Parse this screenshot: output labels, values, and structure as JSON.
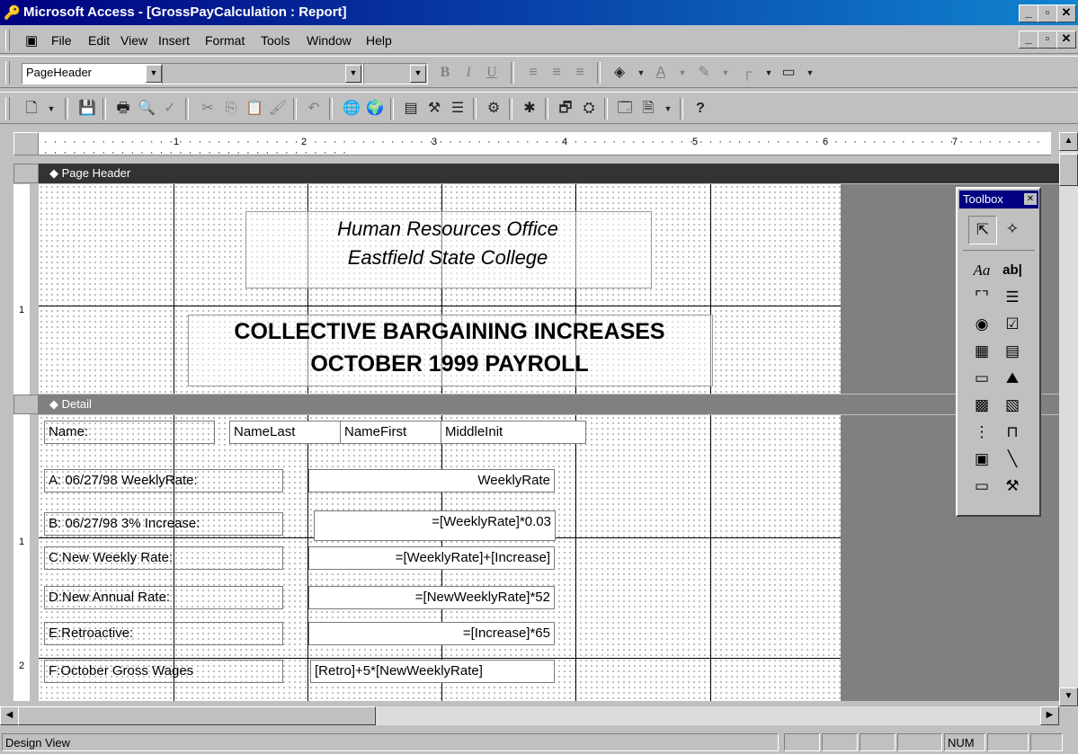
{
  "window": {
    "title": "Microsoft Access - [GrossPayCalculation : Report]"
  },
  "menu": [
    "File",
    "Edit",
    "View",
    "Insert",
    "Format",
    "Tools",
    "Window",
    "Help"
  ],
  "format_toolbar": {
    "object_combo": "PageHeader",
    "font_combo": "",
    "size_combo": ""
  },
  "ruler_marks": [
    "1",
    "2",
    "3",
    "4",
    "5",
    "6",
    "7"
  ],
  "vruler_marks": [
    "1",
    "1",
    "2"
  ],
  "sections": {
    "page_header": "Page Header",
    "detail": "Detail"
  },
  "report": {
    "header_line1": "Human Resources Office",
    "header_line2": "Eastfield State College",
    "title_line1": "COLLECTIVE BARGAINING INCREASES",
    "title_line2": "OCTOBER 1999 PAYROLL",
    "name_label": "Name:",
    "name_last": "NameLast",
    "name_first": "NameFirst",
    "middle_init": "MiddleInit",
    "rows": [
      {
        "label": "A: 06/27/98 WeeklyRate:",
        "value": "WeeklyRate"
      },
      {
        "label": "B: 06/27/98 3% Increase:",
        "value": "=[WeeklyRate]*0.03"
      },
      {
        "label": "C:New Weekly Rate:",
        "value": "=[WeeklyRate]+[Increase]"
      },
      {
        "label": "D:New Annual Rate:",
        "value": "=[NewWeeklyRate]*52"
      },
      {
        "label": "E:Retroactive:",
        "value": "=[Increase]*65"
      },
      {
        "label": "F:October Gross Wages",
        "value": "[Retro]+5*[NewWeeklyRate]"
      }
    ]
  },
  "toolbox": {
    "title": "Toolbox"
  },
  "status": {
    "mode": "Design View",
    "num": "NUM"
  }
}
